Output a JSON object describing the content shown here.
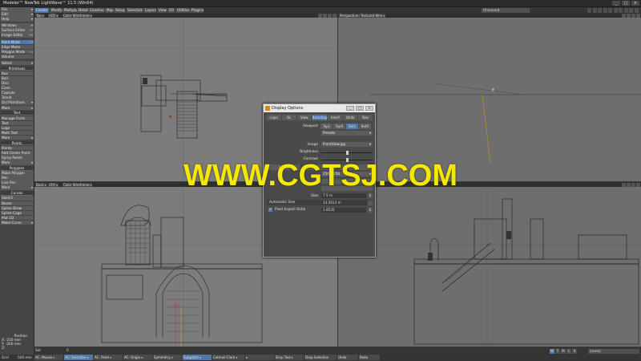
{
  "window": {
    "title": "Modeler™ NewTek LightWave™ 11.5 (Win64)",
    "buttons": [
      "_",
      "□",
      "×"
    ]
  },
  "menu_tabs": [
    "Create",
    "Modify",
    "Multiply",
    "Detail",
    "Construct",
    "Map",
    "Setup",
    "Selection",
    "Layers",
    "View",
    "I/O",
    "Utilities",
    "Plugins"
  ],
  "tabbar_right": {
    "scene": "Unnamed"
  },
  "sidebar": {
    "top": [
      {
        "label": "File",
        "drop": true
      },
      {
        "label": "Edit",
        "drop": true
      },
      {
        "label": "Help",
        "drop": true
      }
    ],
    "windows": {
      "label": "Windows",
      "items": [
        {
          "label": "Surface Editor",
          "key": "F5"
        },
        {
          "label": "Image Editor",
          "key": "F6"
        }
      ]
    },
    "modes": [
      {
        "label": "Point Mode",
        "key": "^G",
        "active": true
      },
      {
        "label": "Edge Mode",
        "key": ""
      },
      {
        "label": "Polygon Mode",
        "key": "^H"
      },
      {
        "label": "Volume",
        "key": ""
      }
    ],
    "select": "Select",
    "primitives": {
      "head": "Primitives",
      "items": [
        "Box",
        "Ball",
        "Disc",
        "Cone",
        "Capsule",
        "Toroid",
        "Uni Primitives"
      ],
      "more": "More"
    },
    "text": {
      "head": "Text",
      "items": [
        "Manage Fonts",
        "Text",
        "Logo",
        "Multi Text"
      ],
      "more": "More"
    },
    "points": {
      "head": "Points",
      "items": [
        "Points",
        "Add Center Point",
        "Spray Points"
      ],
      "more": "More"
    },
    "polygons": {
      "head": "Polygons",
      "items": [
        "Make Polygon",
        "Pen",
        "Line Pen"
      ],
      "more": "More"
    },
    "curves": {
      "head": "Curves",
      "items": [
        "Sketch",
        "Bezier",
        "Spline Draw",
        "Spline Cage",
        "Plot 1D",
        "Make Curve"
      ]
    },
    "position": {
      "label": "Position",
      "x": "-250 mm",
      "y": "-200 mm",
      "z": ""
    }
  },
  "viewports": {
    "top_left": {
      "view": "Top",
      "axis": "(XZ)",
      "mode": "Color Wireframe"
    },
    "top_right": {
      "view": "Perspective",
      "mode": "Textured Wire"
    },
    "bottom_left": {
      "view": "Back",
      "axis": "(XY)",
      "mode": "Color Wireframe"
    },
    "bottom_right": {
      "view": "",
      "mode": ""
    }
  },
  "dialog": {
    "title": "Display Options",
    "tabs": [
      {
        "label": "Layo",
        "active": false
      },
      {
        "label": "GL",
        "active": false
      },
      {
        "label": "View",
        "active": false
      },
      {
        "label": "Backdrop",
        "active": true
      },
      {
        "label": "Interf",
        "active": false
      },
      {
        "label": "Units",
        "active": false
      },
      {
        "label": "Nav",
        "active": false
      }
    ],
    "viewport_label": "Viewport",
    "viewport_opts": [
      {
        "label": "TopL",
        "active": false
      },
      {
        "label": "TopR",
        "active": false
      },
      {
        "label": "BotL",
        "active": true
      },
      {
        "label": "BotR",
        "active": false
      }
    ],
    "presets": "Presets",
    "image_label": "Image",
    "image_value": "FrontView.jpg",
    "brightness_label": "Brightness",
    "brightness": 0.5,
    "contrast_label": "Contrast",
    "contrast": 0.5,
    "invert_label": "Invert",
    "resolution_value": "256 x 256",
    "size_label": "Size",
    "size_value": "7.5 m",
    "auto_size_label": "Automatic Size",
    "auto_size_value": "13.5013 m",
    "aspect_label": "Pixel Aspect Ratio",
    "aspect_value": "1.8535",
    "aspect_checked": "✓",
    "env_icon": "E"
  },
  "watermark": "WWW.CGTSJ.COM",
  "selection_bar": {
    "sel_label": "Sel:",
    "sel_value": "0"
  },
  "bottom_bar": [
    {
      "label": "AC: Mouse",
      "active": false,
      "drop": true
    },
    {
      "label": "AC: Selection",
      "active": true,
      "drop": true
    },
    {
      "label": "AC: Point",
      "active": false,
      "drop": true
    },
    {
      "label": "AC: Origin",
      "active": false,
      "drop": true
    },
    {
      "label": "Symmetry",
      "active": false,
      "drop": true
    },
    {
      "label": "Subpatch",
      "active": true,
      "drop": true
    },
    {
      "label": "Catmull-Clark",
      "active": false,
      "drop": true
    },
    {
      "label": "",
      "active": false,
      "drop": true
    },
    {
      "label": "Drop Tool",
      "active": false,
      "drop": true
    },
    {
      "label": "Drop Selection",
      "active": false,
      "drop": false
    },
    {
      "label": "Undo",
      "active": false,
      "drop": false
    },
    {
      "label": "Redo",
      "active": false,
      "drop": false
    }
  ],
  "layer_buttons": [
    {
      "label": "W",
      "active": true
    },
    {
      "label": "T",
      "active": false
    },
    {
      "label": "M",
      "active": false
    },
    {
      "label": "C",
      "active": false
    },
    {
      "label": "S",
      "active": false
    }
  ],
  "layer_dropdown": "(none)",
  "grid": {
    "label": "Grid",
    "value": "500 mm"
  }
}
